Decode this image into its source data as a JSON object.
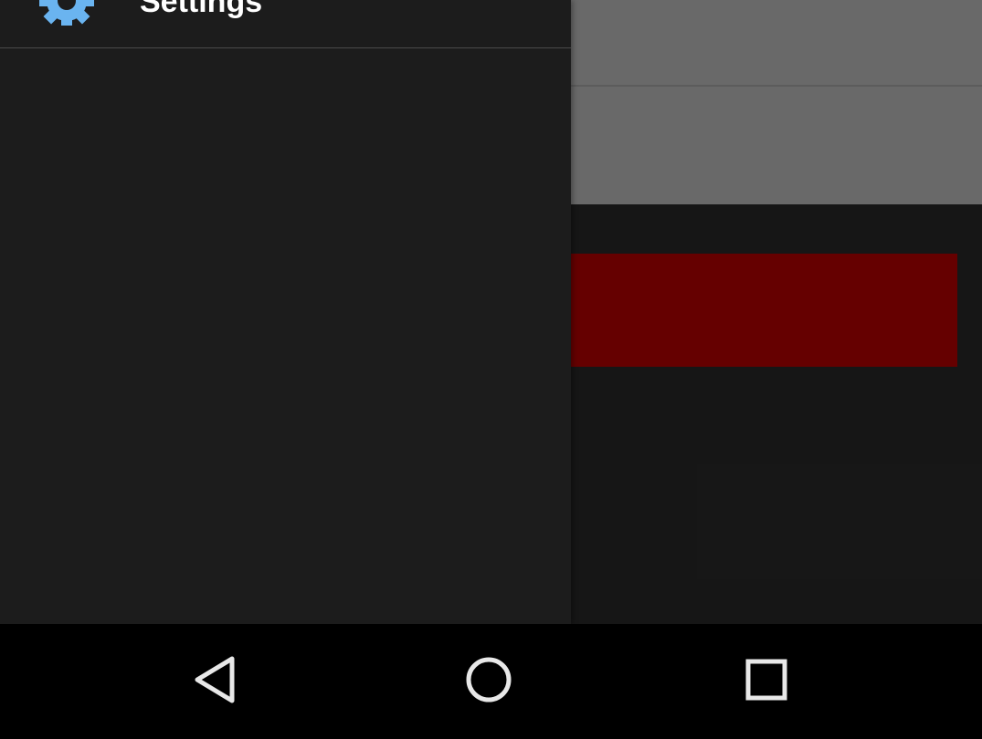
{
  "drawer": {
    "items": [
      {
        "label": "Settings",
        "icon": "gear-icon",
        "icon_color": "#6ab4f0"
      }
    ]
  },
  "app": {
    "primary_button_color": "#a80000",
    "toolbar_color": "#b0b0b0"
  },
  "navbar": {
    "buttons": [
      {
        "name": "back",
        "icon": "back-triangle-icon"
      },
      {
        "name": "home",
        "icon": "home-circle-icon"
      },
      {
        "name": "recents",
        "icon": "recents-square-icon"
      }
    ],
    "icon_color": "#e8e8e8"
  }
}
